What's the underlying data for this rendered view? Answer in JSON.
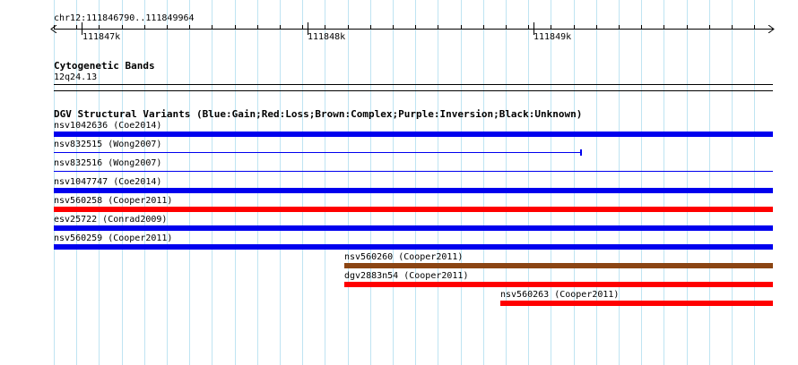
{
  "ruler": {
    "coordinate_range": "chr12:111846790..111849964",
    "major_ticks": [
      "111847k",
      "111848k",
      "111849k"
    ]
  },
  "cytogenetic": {
    "title": "Cytogenetic Bands",
    "band_label": "12q24.13"
  },
  "dgv": {
    "title": "DGV Structural Variants (Blue:Gain;Red:Loss;Brown:Complex;Purple:Inversion;Black:Unknown)",
    "variants": [
      {
        "label": "nsv1042636 (Coe2014)",
        "color": "#0000ee",
        "style": "thick"
      },
      {
        "label": "nsv832515 (Wong2007)",
        "color": "#0000ee",
        "style": "thin-capped"
      },
      {
        "label": "nsv832516 (Wong2007)",
        "color": "#0000ee",
        "style": "thin"
      },
      {
        "label": "nsv1047747 (Coe2014)",
        "color": "#0000ee",
        "style": "thick"
      },
      {
        "label": "nsv560258 (Cooper2011)",
        "color": "#ff0000",
        "style": "thick"
      },
      {
        "label": "esv25722 (Conrad2009)",
        "color": "#0000ee",
        "style": "thick"
      },
      {
        "label": "nsv560259 (Cooper2011)",
        "color": "#0000ee",
        "style": "thick"
      },
      {
        "label": "nsv560260 (Cooper2011)",
        "color": "#8b4513",
        "style": "thick"
      },
      {
        "label": "dgv2883n54 (Cooper2011)",
        "color": "#ff0000",
        "style": "thick"
      },
      {
        "label": "nsv560263 (Cooper2011)",
        "color": "#ff0000",
        "style": "thick"
      }
    ]
  },
  "colors": {
    "grid_line": "#bfe4f2",
    "gain": "#0000ee",
    "loss": "#ff0000",
    "complex": "#8b4513"
  }
}
